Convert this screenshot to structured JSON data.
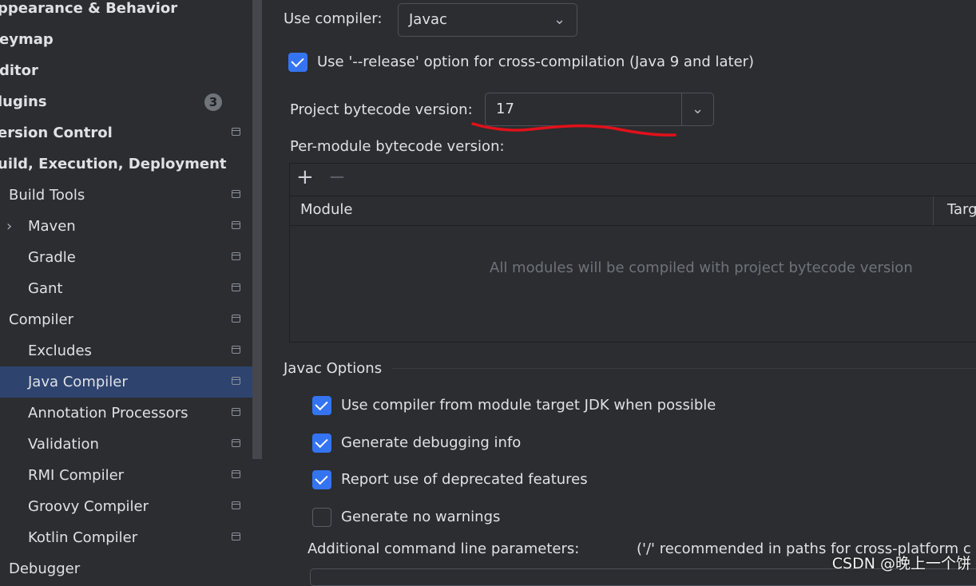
{
  "sidebar": {
    "items": [
      {
        "label": "ppearance & Behavior",
        "bold": true
      },
      {
        "label": "eymap",
        "bold": true
      },
      {
        "label": "ditor",
        "bold": true
      },
      {
        "label": "lugins",
        "bold": true,
        "badge": "3"
      },
      {
        "label": "ersion Control",
        "bold": true
      },
      {
        "label": "uild, Execution, Deployment",
        "bold": true
      },
      {
        "label": "Build Tools"
      },
      {
        "label": "Maven"
      },
      {
        "label": "Gradle"
      },
      {
        "label": "Gant"
      },
      {
        "label": "Compiler"
      },
      {
        "label": "Excludes"
      },
      {
        "label": "Java Compiler",
        "selected": true
      },
      {
        "label": "Annotation Processors"
      },
      {
        "label": "Validation"
      },
      {
        "label": "RMI Compiler"
      },
      {
        "label": "Groovy Compiler"
      },
      {
        "label": "Kotlin Compiler"
      },
      {
        "label": "Debugger"
      }
    ]
  },
  "main": {
    "use_compiler_label": "Use compiler:",
    "use_compiler_value": "Javac",
    "release_option_label": "Use '--release' option for cross-compilation (Java 9 and later)",
    "release_option_checked": true,
    "bytecode_label": "Project bytecode version:",
    "bytecode_value": "17",
    "per_module_label": "Per-module bytecode version:",
    "table": {
      "add_icon": "+",
      "remove_icon": "−",
      "col_module": "Module",
      "col_target": "Targ",
      "empty_text": "All modules will be compiled with project bytecode version"
    },
    "javac_options_title": "Javac Options",
    "options": [
      {
        "label": "Use compiler from module target JDK when possible",
        "checked": true
      },
      {
        "label": "Generate debugging info",
        "checked": true
      },
      {
        "label": "Report use of deprecated features",
        "checked": true
      },
      {
        "label": "Generate no warnings",
        "checked": false
      }
    ],
    "cmd_params_label": "Additional command line parameters:",
    "cmd_params_hint": "('/' recommended in paths for cross-platform c"
  },
  "annotation_color": "#e0111b",
  "watermark": "CSDN @晚上一个饼"
}
